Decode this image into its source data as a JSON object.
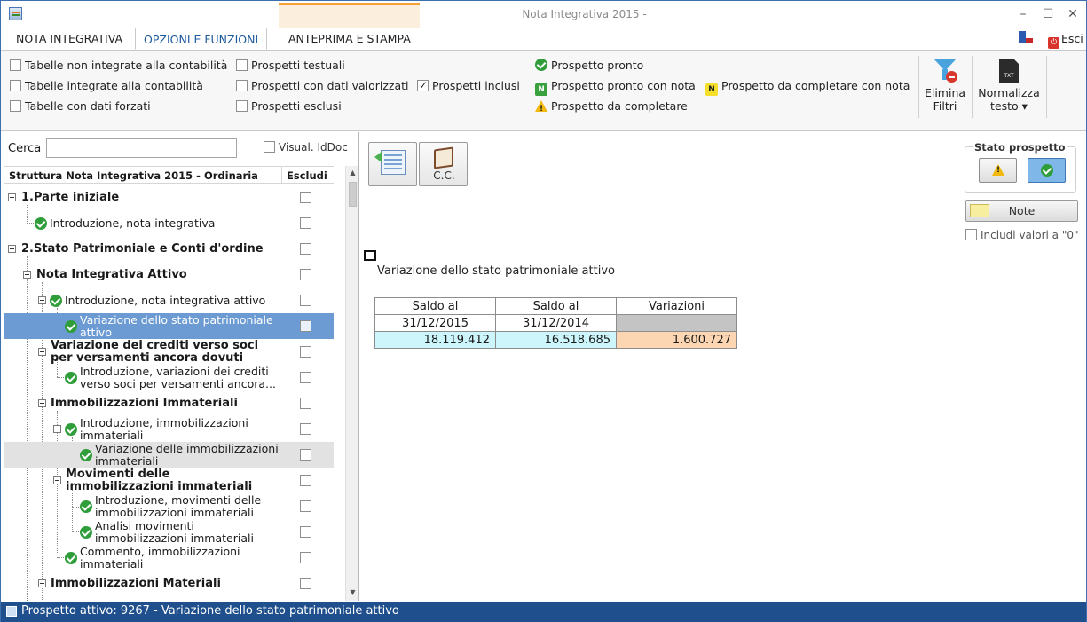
{
  "window": {
    "title": "Nota Integrativa 2015 -"
  },
  "tabs": [
    {
      "label": "NOTA INTEGRATIVA"
    },
    {
      "label": "OPZIONI E FUNZIONI"
    },
    {
      "label": "ANTEPRIMA E STAMPA"
    }
  ],
  "header": {
    "exit_label": "Esci"
  },
  "ribbon": {
    "filters": [
      {
        "label": "Tabelle non integrate alla contabilità",
        "checked": false
      },
      {
        "label": "Tabelle integrate alla contabilità",
        "checked": false
      },
      {
        "label": "Tabelle con dati forzati",
        "checked": false
      },
      {
        "label": "Prospetti testuali",
        "checked": false
      },
      {
        "label": "Prospetti con dati valorizzati",
        "checked": false
      },
      {
        "label": "Prospetti esclusi",
        "checked": false
      },
      {
        "label": "Prospetti inclusi",
        "checked": true
      }
    ],
    "legend": [
      {
        "label": "Prospetto pronto",
        "icon": "ok-icon"
      },
      {
        "label": "Prospetto pronto con nota",
        "icon": "note-green-icon"
      },
      {
        "label": "Prospetto da completare con nota",
        "icon": "note-yellow-icon"
      },
      {
        "label": "Prospetto da completare",
        "icon": "warning-icon"
      }
    ],
    "elimina_filtri": {
      "line1": "Elimina",
      "line2": "Filtri"
    },
    "normalizza_testo": {
      "line1": "Normalizza",
      "line2": "testo ▾"
    },
    "txt_icon_text": "TXT"
  },
  "left": {
    "search_label": "Cerca",
    "search_value": "",
    "visual_iddoc_label": "Visual. IdDoc",
    "tree_header": "Struttura Nota Integrativa 2015 - Ordinaria",
    "exclude_header": "Escludi",
    "items": [
      {
        "label": "1.Parte iniziale"
      },
      {
        "label": "Introduzione, nota integrativa"
      },
      {
        "label": "2.Stato Patrimoniale e Conti d'ordine"
      },
      {
        "label": "Nota Integrativa Attivo"
      },
      {
        "label": "Introduzione, nota integrativa attivo"
      },
      {
        "label": "Variazione dello stato patrimoniale attivo"
      },
      {
        "label": "Variazione dei crediti verso soci per versamenti ancora dovuti"
      },
      {
        "label": "Introduzione, variazioni dei crediti verso soci per versamenti ancora..."
      },
      {
        "label": "Immobilizzazioni Immateriali"
      },
      {
        "label": "Introduzione, immobilizzazioni immateriali"
      },
      {
        "label": "Variazione delle immobilizzazioni immateriali"
      },
      {
        "label": "Movimenti delle immobilizzazioni immateriali"
      },
      {
        "label": "Introduzione, movimenti delle immobilizzazioni immateriali"
      },
      {
        "label": "Analisi movimenti immobilizzazioni immateriali"
      },
      {
        "label": "Commento, immobilizzazioni immateriali"
      },
      {
        "label": "Immobilizzazioni Materiali"
      }
    ]
  },
  "main": {
    "cc_label": "C.C.",
    "stato_title": "Stato prospetto",
    "note_label": "Note",
    "includi_label": "Includi valori a \"0\"",
    "section_title": "Variazione dello stato patrimoniale attivo",
    "table": {
      "headers": [
        "Saldo al",
        "Saldo al",
        "Variazioni"
      ],
      "dates": [
        "31/12/2015",
        "31/12/2014",
        ""
      ],
      "values": [
        "18.119.412",
        "16.518.685",
        "1.600.727"
      ]
    }
  },
  "status": {
    "text": "Prospetto attivo: 9267 - Variazione dello stato patrimoniale attivo"
  },
  "colors": {
    "accent": "#1e5a9e",
    "status_bar": "#1f4f8c",
    "selected_row": "#6b9bd2",
    "preview_tab": "#f4a033"
  }
}
